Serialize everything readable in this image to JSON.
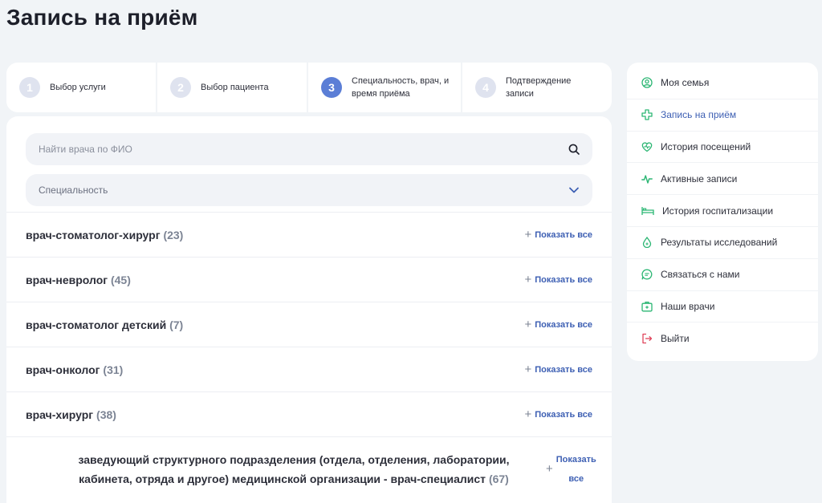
{
  "page": {
    "title": "Запись на приём"
  },
  "steps": [
    {
      "num": "1",
      "label": "Выбор услуги"
    },
    {
      "num": "2",
      "label": "Выбор пациента"
    },
    {
      "num": "3",
      "label": "Специальность, врач, и время приёма"
    },
    {
      "num": "4",
      "label": "Подтверждение записи"
    }
  ],
  "search": {
    "placeholder": "Найти врача по ФИО",
    "value": ""
  },
  "specialty_select": {
    "label": "Специальность"
  },
  "specialties": [
    {
      "name": "врач-стоматолог-хирург",
      "count": "(23)"
    },
    {
      "name": "врач-невролог",
      "count": "(45)"
    },
    {
      "name": "врач-стоматолог детский",
      "count": "(7)"
    },
    {
      "name": "врач-онколог",
      "count": "(31)"
    },
    {
      "name": "врач-хирург",
      "count": "(38)"
    },
    {
      "name": "заведующий структурного подразделения (отдела, отделения, лаборатории, кабинета, отряда и другое) медицинской организации - врач-специалист",
      "count": "(67)"
    }
  ],
  "show_all_label": "Показать все",
  "sidebar": {
    "items": [
      {
        "label": "Моя семья",
        "icon": "family-icon"
      },
      {
        "label": "Запись на приём",
        "icon": "medical-cross-icon",
        "active": true
      },
      {
        "label": "История посещений",
        "icon": "heart-pulse-icon"
      },
      {
        "label": "Активные записи",
        "icon": "pulse-icon"
      },
      {
        "label": "История госпитализации",
        "icon": "bed-icon"
      },
      {
        "label": "Результаты исследований",
        "icon": "drop-icon"
      },
      {
        "label": "Связаться с нами",
        "icon": "chat-icon"
      },
      {
        "label": "Наши врачи",
        "icon": "medkit-icon"
      },
      {
        "label": "Выйти",
        "icon": "logout-icon"
      }
    ]
  },
  "colors": {
    "accent": "#5b7ed6",
    "link": "#3d5fb3",
    "icon_green": "#2bb673",
    "logout_red": "#e0445b"
  }
}
